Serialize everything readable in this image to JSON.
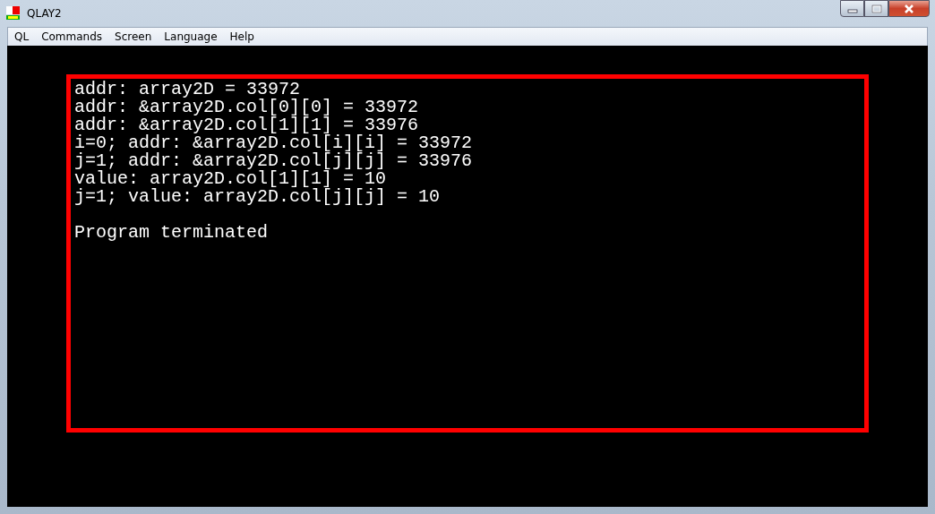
{
  "window": {
    "title": "QLAY2"
  },
  "menu": [
    {
      "label": "QL"
    },
    {
      "label": "Commands"
    },
    {
      "label": "Screen"
    },
    {
      "label": "Language"
    },
    {
      "label": "Help"
    }
  ],
  "screen": {
    "output_lines": [
      "addr: array2D = 33972",
      "addr: &array2D.col[0][0] = 33972",
      "addr: &array2D.col[1][1] = 33976",
      "i=0; addr: &array2D.col[i][i] = 33972",
      "j=1; addr: &array2D.col[j][j] = 33976",
      "value: array2D.col[1][1] = 10",
      "j=1; value: array2D.col[j][j] = 10"
    ],
    "status_line": "Program terminated"
  }
}
